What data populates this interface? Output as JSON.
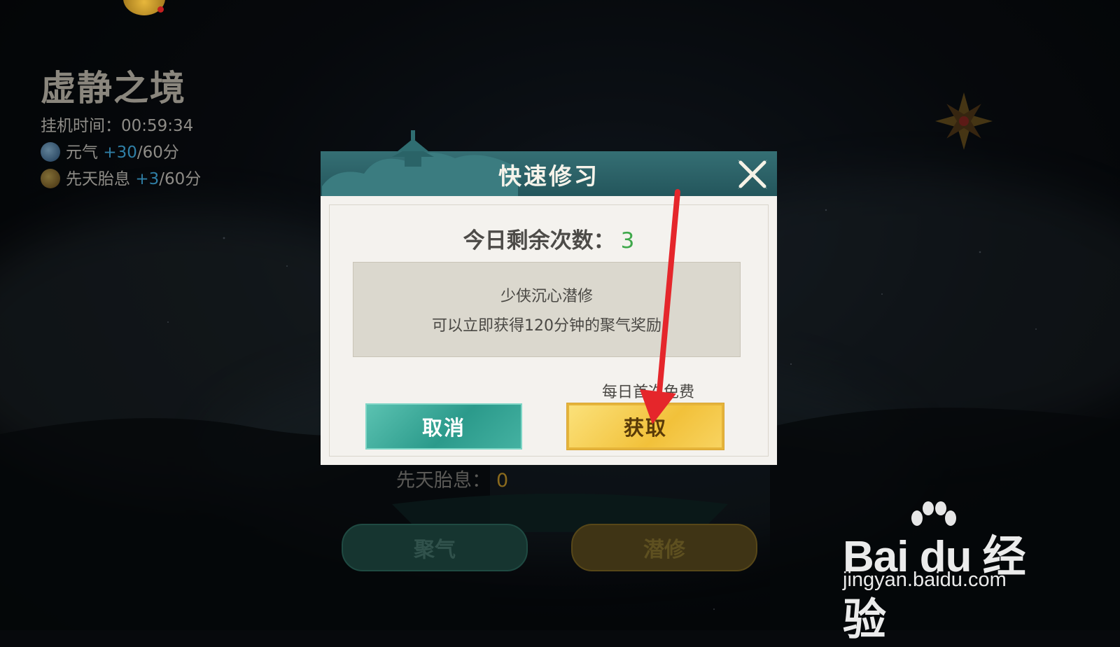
{
  "hud": {
    "realm_title": "虚静之境",
    "idle_time_label": "挂机时间：",
    "idle_time_value": "00:59:34",
    "yuanqi_label": "元气",
    "yuanqi_plus": "+30",
    "yuanqi_rate": "/60分",
    "xiantian_label": "先天胎息",
    "xiantian_plus": "+3",
    "xiantian_rate": "/60分"
  },
  "background": {
    "xiantian_stat_label": "先天胎息：",
    "xiantian_stat_value": "0",
    "juqi_button": "聚气",
    "qianxiu_button": "潜修"
  },
  "modal": {
    "title": "快速修习",
    "remaining_label": "今日剩余次数：",
    "remaining_count": "3",
    "desc_line1": "少侠沉心潜修",
    "desc_line2": "可以立即获得120分钟的聚气奖励",
    "free_note": "每日首次免费",
    "cancel_label": "取消",
    "confirm_label": "获取"
  },
  "watermark": {
    "logo_text": "Bai du 经验",
    "url": "jingyan.baidu.com"
  },
  "colors": {
    "modal_header": "#2b6166",
    "remaining_count": "#3fa84b",
    "cancel_button": "#3aa99a",
    "confirm_button": "#f2c13a",
    "arrow": "#e5262b"
  }
}
